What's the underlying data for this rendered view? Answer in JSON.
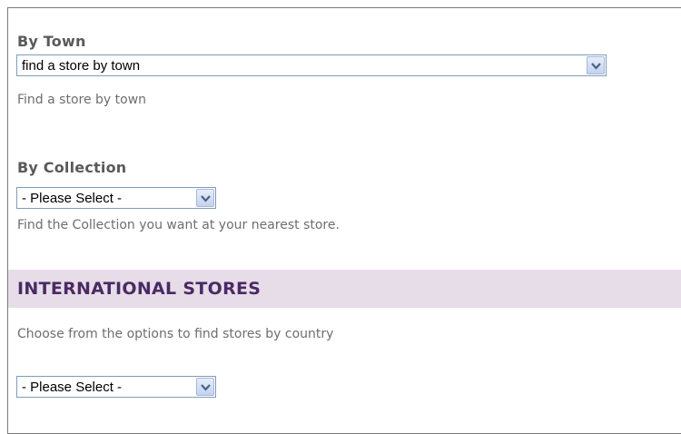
{
  "by_town": {
    "label": "By Town",
    "selected": "find a store by town",
    "help": "Find a store by town"
  },
  "by_collection": {
    "label": "By Collection",
    "selected": "- Please Select -",
    "help": "Find the Collection you want at your nearest store."
  },
  "international": {
    "title": "INTERNATIONAL STORES",
    "help": "Choose from the options to find stores by country",
    "selected": "- Please Select -"
  },
  "icons": {
    "dropdown": "chevron-down-icon"
  },
  "colors": {
    "header_bg": "#e6dde8",
    "header_text": "#4a2a64",
    "select_border": "#7f9db9"
  }
}
